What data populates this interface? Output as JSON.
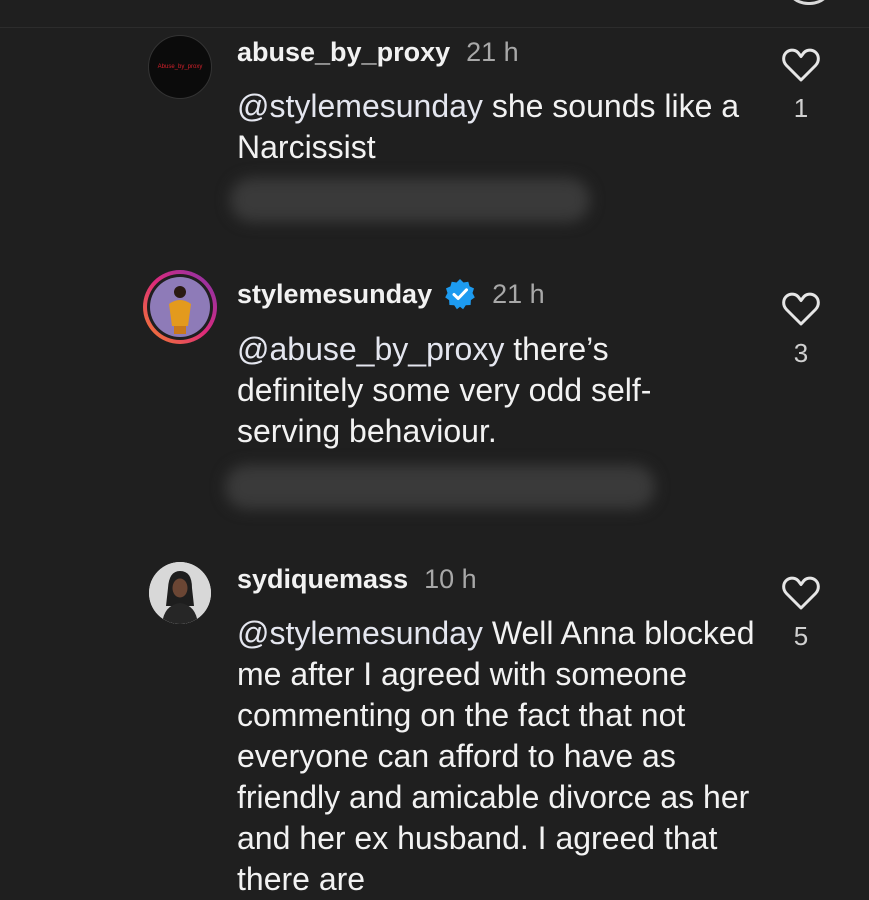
{
  "comments": [
    {
      "username": "abuse_by_proxy",
      "time": "21 h",
      "mention": "@stylemesunday",
      "text_line1_rest": "she sounds",
      "text_rest": "like a Narcissist",
      "likes": "1",
      "avatar_text": "Abuse_by_proxy"
    },
    {
      "username": "stylemesunday",
      "verified": true,
      "time": "21 h",
      "mention": "@abuse_by_proxy",
      "text_line1_rest": "there’s",
      "text_rest": "definitely some very odd self-serving behaviour.",
      "likes": "3"
    },
    {
      "username": "sydiquemass",
      "time": "10 h",
      "mention": "@stylemesunday",
      "text_line1_rest": "Well Anna",
      "text_rest": "blocked me after I agreed with someone commenting on the fact that not everyone can afford to have as friendly and amicable divorce as her and her ex husband. I agreed that there are",
      "likes": "5"
    }
  ],
  "icons": {
    "like": "heart-outline-icon",
    "verified": "verified-badge-icon"
  },
  "colors": {
    "background": "#1f1f1f",
    "text": "#f2f2f2",
    "secondary": "#a8a8a8",
    "verified": "#1d9bf0"
  }
}
